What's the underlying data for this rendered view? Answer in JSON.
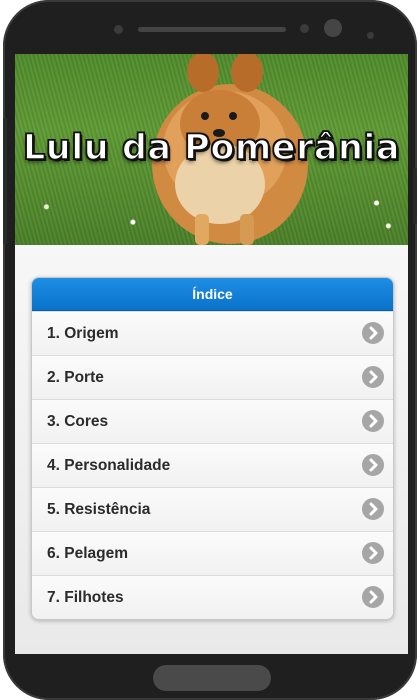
{
  "header": {
    "title": "Lulu da Pomerânia"
  },
  "index": {
    "title": "Índice",
    "items": [
      {
        "label": "1. Origem"
      },
      {
        "label": "2. Porte"
      },
      {
        "label": "3. Cores"
      },
      {
        "label": "4. Personalidade"
      },
      {
        "label": "5. Resistência"
      },
      {
        "label": "6. Pelagem"
      },
      {
        "label": "7. Filhotes"
      }
    ]
  },
  "icons": {
    "item_arrow": "chevron-right-icon"
  },
  "colors": {
    "accent": "#0f7fd8",
    "phone_frame": "#1f1f1f",
    "chevron_circle": "#a6a6a6"
  }
}
